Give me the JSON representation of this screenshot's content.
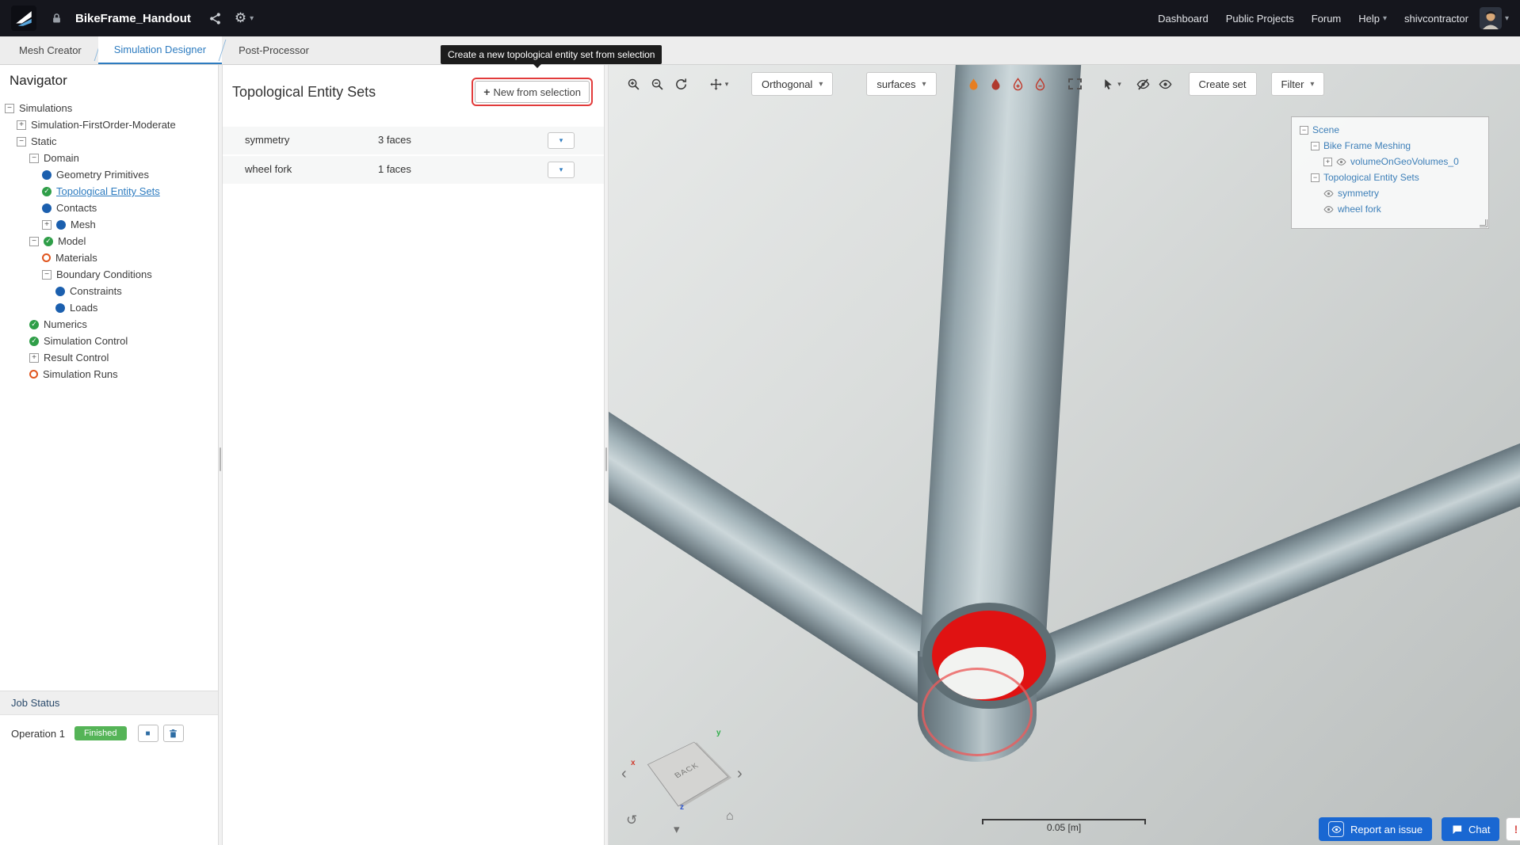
{
  "header": {
    "project_title": "BikeFrame_Handout",
    "nav": {
      "dashboard": "Dashboard",
      "public_projects": "Public Projects",
      "forum": "Forum",
      "help": "Help"
    },
    "username": "shivcontractor"
  },
  "tabs": {
    "mesh_creator": "Mesh Creator",
    "simulation_designer": "Simulation Designer",
    "post_processor": "Post-Processor"
  },
  "tooltip": {
    "text": "Create a new topological entity set from selection"
  },
  "navigator": {
    "title": "Navigator",
    "tree": [
      {
        "label": "Simulations"
      },
      {
        "label": "Simulation-FirstOrder-Moderate"
      },
      {
        "label": "Static"
      },
      {
        "label": "Domain"
      },
      {
        "label": "Geometry Primitives"
      },
      {
        "label": "Topological Entity Sets"
      },
      {
        "label": "Contacts"
      },
      {
        "label": "Mesh"
      },
      {
        "label": "Model"
      },
      {
        "label": "Materials"
      },
      {
        "label": "Boundary Conditions"
      },
      {
        "label": "Constraints"
      },
      {
        "label": "Loads"
      },
      {
        "label": "Numerics"
      },
      {
        "label": "Simulation Control"
      },
      {
        "label": "Result Control"
      },
      {
        "label": "Simulation Runs"
      }
    ],
    "job_status": {
      "title": "Job Status",
      "operation": "Operation 1",
      "status": "Finished"
    }
  },
  "entity_panel": {
    "title": "Topological Entity Sets",
    "new_button": "New from selection",
    "rows": [
      {
        "name": "symmetry",
        "count": "3 faces"
      },
      {
        "name": "wheel fork",
        "count": "1 faces"
      }
    ]
  },
  "viewport": {
    "toolbar": {
      "orthogonal": "Orthogonal",
      "surfaces": "surfaces",
      "create_set": "Create set",
      "filter": "Filter"
    },
    "scene_tree": [
      {
        "label": "Scene"
      },
      {
        "label": "Bike Frame Meshing"
      },
      {
        "label": "volumeOnGeoVolumes_0"
      },
      {
        "label": "Topological Entity Sets"
      },
      {
        "label": "symmetry"
      },
      {
        "label": "wheel fork"
      }
    ],
    "nav_cube_label": "BACK",
    "scale_label": "0.05 [m]",
    "report_button": "Report an issue",
    "chat_button": "Chat",
    "alert": "!"
  },
  "icons": {
    "chevron_down": "▾",
    "plus": "+",
    "minus": "−",
    "check": "✓",
    "stop": "■",
    "home": "⌂",
    "rotate": "↺",
    "arrow_left": "‹",
    "arrow_right": "›",
    "gear": "⚙"
  },
  "colors": {
    "accent_blue": "#2e7cc0",
    "highlight_red": "#e23b3b",
    "selection_red": "#e01212",
    "finished_green": "#55b457",
    "report_blue": "#1967d2",
    "topbar_dark": "#15161d"
  }
}
